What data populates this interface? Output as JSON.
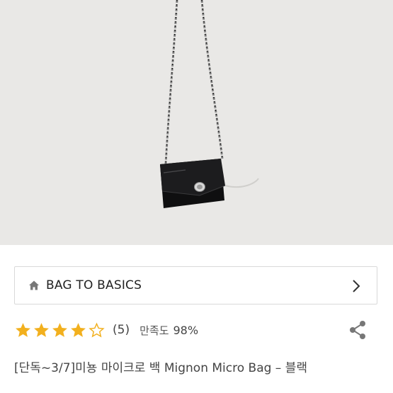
{
  "brand": {
    "name": "BAG TO BASICS",
    "home_icon": "home-icon",
    "chevron_icon": "chevron-right-icon"
  },
  "rating": {
    "stars_value": 4.5,
    "stars_max": 5,
    "review_count": "(5)",
    "satisfaction_label": "만족도",
    "satisfaction_value": "98%",
    "star_color": "#f2b01e"
  },
  "share": {
    "icon": "share-icon"
  },
  "product": {
    "title": "[단독~3/7]미뇽 마이크로 백 Mignon Micro Bag – 블랙"
  }
}
